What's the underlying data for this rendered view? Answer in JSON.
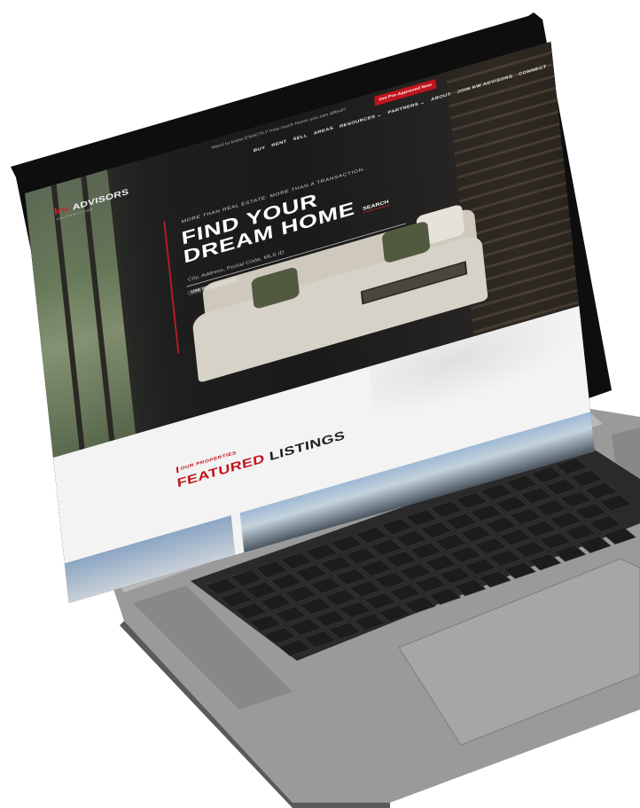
{
  "promo": {
    "text": "Want to know EXACTLY how much home you can afford?",
    "button_label": "Get Pre-Approved Now"
  },
  "nav": {
    "items": [
      "BUY",
      "RENT",
      "SELL",
      "AREAS",
      "RESOURCES ⌄",
      "PARTNERS ⌄",
      "ABOUT",
      "JOIN KW ADVISORS",
      "CONNECT"
    ]
  },
  "logo": {
    "mark": "kw",
    "name": "ADVISORS",
    "subtitle": "KELLERWILLIAMS"
  },
  "hero": {
    "tagline": "MORE THAN REAL ESTATE. MORE THAN A TRANSACTION.",
    "headline_line1": "FIND YOUR",
    "headline_line2": "DREAM HOME",
    "search_placeholder": "City, Address, Postal Code, MLS ID",
    "search_label": "SEARCH",
    "location_label": "USE MY LOCATION"
  },
  "featured": {
    "label": "OUR PROPERTIES",
    "title_red": "FEATURED",
    "title_dark": "LISTINGS"
  },
  "colors": {
    "accent": "#c2141c",
    "hero_bg": "#1b1b1b",
    "section_bg": "#f3f3f3",
    "laptop_body": "#8e8e8e",
    "keys": "#1f1f1f"
  }
}
